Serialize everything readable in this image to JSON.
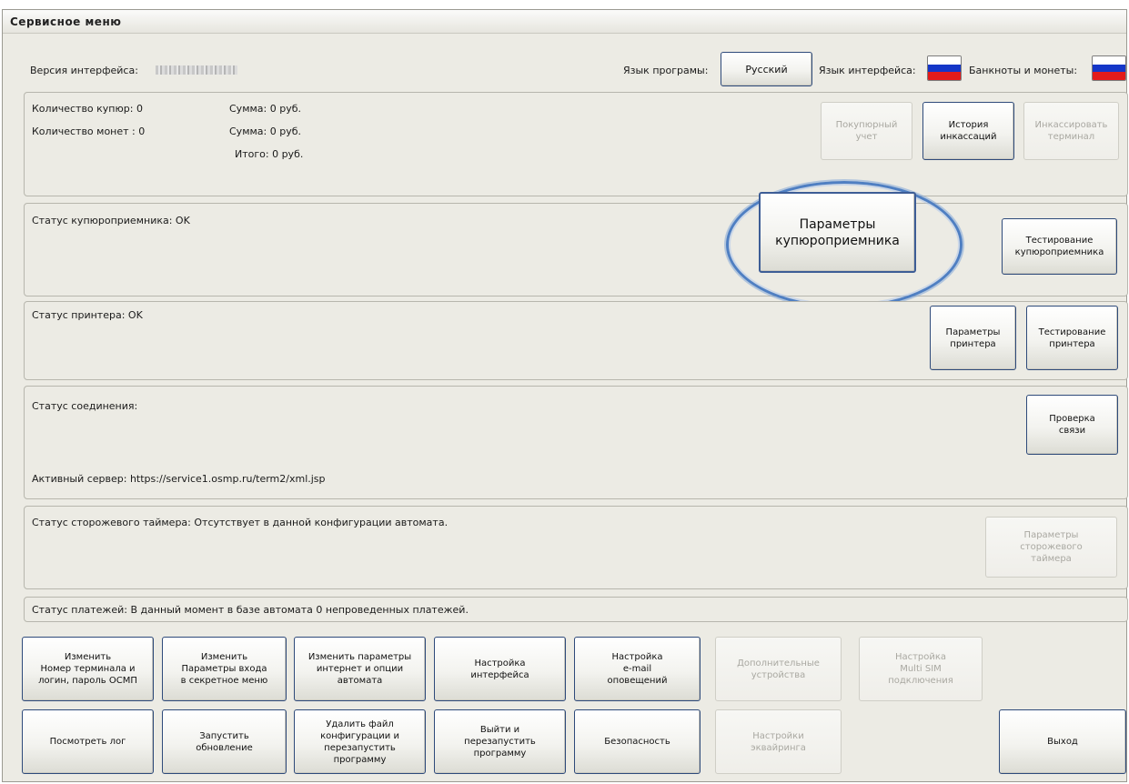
{
  "window": {
    "title": "Сервисное меню"
  },
  "header": {
    "version_label": "Версия интерфейса:",
    "program_lang_label": "Язык програмы:",
    "program_lang_button": "Русский",
    "interface_lang_label": "Язык интерфейса:",
    "notes_coins_label": "Банкноты и монеты:"
  },
  "flag_colors": [
    "#ffffff",
    "#1436c8",
    "#e21b1b"
  ],
  "counts": {
    "notes_label": "Количество купюр: 0",
    "coins_label": "Количество монет : 0",
    "sum1": "Сумма: 0 руб.",
    "sum2": "Сумма: 0 руб.",
    "total": "Итого: 0 руб."
  },
  "count_buttons": {
    "buyer_account": "Покупюрный\nучет",
    "collection_history": "История\nинкассаций",
    "collect_terminal": "Инкассировать\nтерминал"
  },
  "bill_acceptor": {
    "status": "Статус купюроприемника: OK",
    "params_button": "Параметры\nкупюроприемника",
    "test_button": "Тестирование\nкупюроприемника"
  },
  "printer": {
    "status": "Статус принтера: OK",
    "params_button": "Параметры\nпринтера",
    "test_button": "Тестирование\nпринтера"
  },
  "connection": {
    "status": "Статус соединения:",
    "check_button": "Проверка\nсвязи",
    "server": "Активный сервер: https://service1.osmp.ru/term2/xml.jsp"
  },
  "watchdog": {
    "status": "Статус сторожевого таймера: Отсутствует в данной конфигурации автомата.",
    "params_button": "Параметры\nсторожевого\nтаймера"
  },
  "payments": {
    "status": "Статус платежей: В данный момент в базе автомата 0 непроведенных платежей."
  },
  "bottom_row1": [
    "Изменить\nНомер терминала и\nлогин, пароль ОСМП",
    "Изменить\nПараметры входа\nв секретное меню",
    "Изменить параметры\nинтернет и опции\nавтомата",
    "Настройка\nинтерфейса",
    "Настройка\ne-mail\nоповещений",
    "Дополнительные\nустройства",
    "Настройка\nMulti SIM\nподключения"
  ],
  "bottom_row2": [
    "Посмотреть лог",
    "Запустить\nобновление",
    "Удалить файл\nконфигурации и\nперезапустить\nпрограмму",
    "Выйти и\nперезапустить\nпрограмму",
    "Безопасность",
    "Настройки\nэквайринга",
    "Выход"
  ]
}
